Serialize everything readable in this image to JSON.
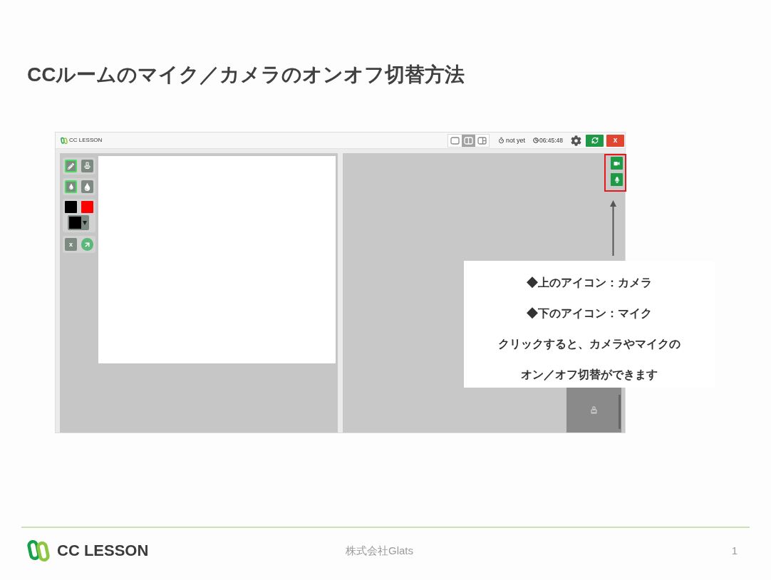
{
  "slide": {
    "title": "CCルームのマイク／カメラのオンオフ切替方法"
  },
  "app_window": {
    "header": {
      "logo_text": "CC LESSON",
      "layout_options": [
        {
          "kind": "single",
          "selected": false
        },
        {
          "kind": "split",
          "selected": true
        },
        {
          "kind": "side",
          "selected": false
        }
      ],
      "status": "not yet",
      "timer": "06:45:48",
      "close_label": "x"
    },
    "toolbox": {
      "tools": [
        {
          "kind": "pen",
          "selected": true
        },
        {
          "kind": "stamp",
          "selected": false
        }
      ],
      "sizes": [
        {
          "kind": "small",
          "selected": true
        },
        {
          "kind": "large",
          "selected": false
        }
      ],
      "swatches": [
        {
          "color": "#000000"
        },
        {
          "color": "#ff0000"
        }
      ],
      "color_dropdown": {
        "color": "#000000"
      },
      "actions": [
        {
          "kind": "clear",
          "label": "x"
        },
        {
          "kind": "arrow"
        }
      ]
    },
    "media_controls": [
      {
        "kind": "camera",
        "on": true
      },
      {
        "kind": "microphone",
        "on": true
      }
    ]
  },
  "callout": {
    "lines": [
      "◆上のアイコン：カメラ",
      "◆下のアイコン：マイク",
      "クリックすると、カメラやマイクの",
      "オン／オフ切替ができます"
    ]
  },
  "footer": {
    "logo_text": "CC LESSON",
    "company": "株式会社Glats",
    "page": "1"
  }
}
